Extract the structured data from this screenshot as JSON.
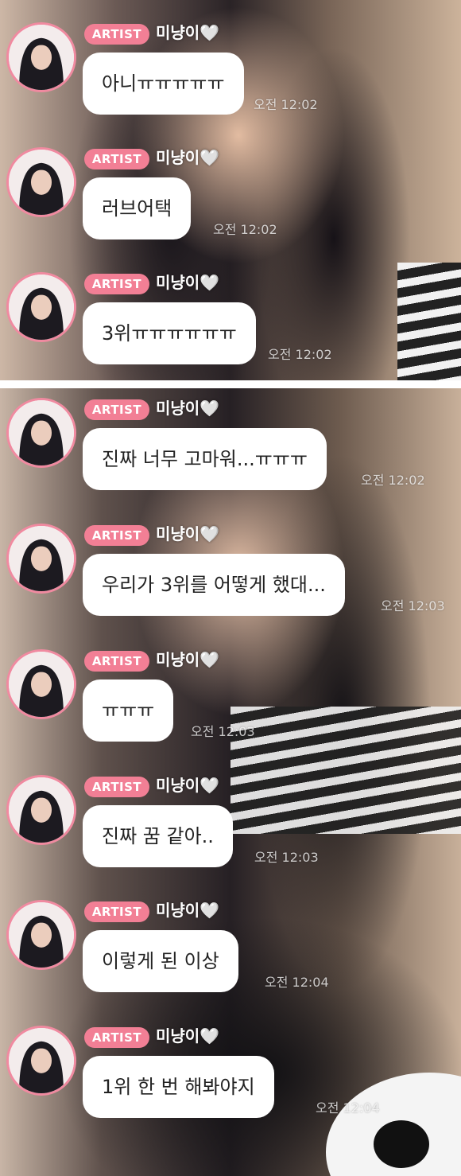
{
  "sender": {
    "badge": "ARTIST",
    "name": "미냥이🤍"
  },
  "colors": {
    "badge_bg": "#f27f95",
    "avatar_ring": "#f08aa0",
    "bubble_bg": "#ffffff"
  },
  "panels": [
    {
      "messages": [
        {
          "text": "아니ㅠㅠㅠㅠㅠ",
          "time": "오전 12:02"
        },
        {
          "text": "러브어택",
          "time": "오전 12:02"
        },
        {
          "text": "3위ㅠㅠㅠㅠㅠㅠ",
          "time": "오전 12:02"
        }
      ]
    },
    {
      "messages": [
        {
          "text": "진짜 너무 고마워...ㅠㅠㅠ",
          "time": "오전 12:02"
        },
        {
          "text": "우리가 3위를 어떻게 했대...",
          "time": "오전 12:03"
        },
        {
          "text": "ㅠㅠㅠ",
          "time": "오전 12:03"
        },
        {
          "text": "진짜 꿈 같아..",
          "time": "오전 12:03"
        },
        {
          "text": "이렇게 된 이상",
          "time": "오전 12:04"
        },
        {
          "text": "1위 한 번 해봐야지",
          "time": "오전 12:04"
        }
      ]
    }
  ]
}
